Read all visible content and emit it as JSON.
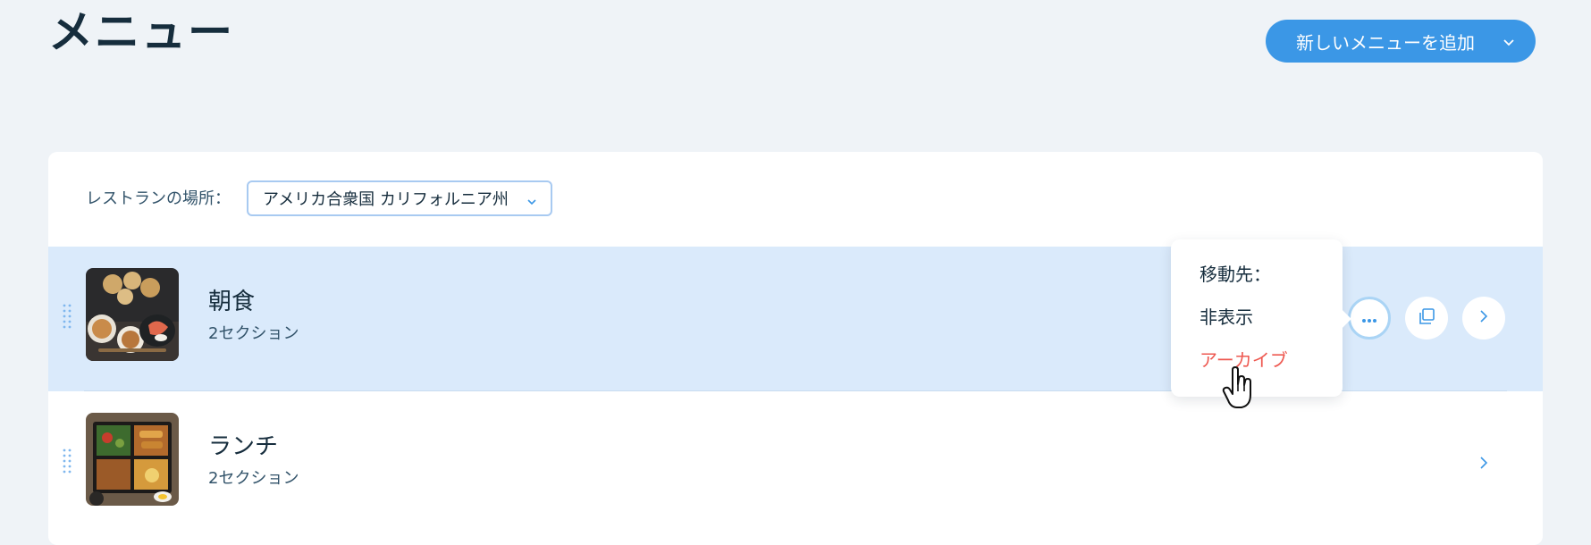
{
  "header": {
    "title": "メニュー",
    "add_button_label": "新しいメニューを追加"
  },
  "filter": {
    "location_label": "レストランの場所：",
    "location_value": "アメリカ合衆国 カリフォルニア州"
  },
  "menus": [
    {
      "name": "朝食",
      "sections": "2セクション",
      "image": "breakfast-photo"
    },
    {
      "name": "ランチ",
      "sections": "2セクション",
      "image": "lunch-bento-photo"
    }
  ],
  "context_menu": {
    "items": [
      "移動先：",
      "非表示",
      "アーカイブ"
    ]
  },
  "icons": {
    "add_button": "chevron-down-icon",
    "location_select": "chevron-down-icon",
    "drag": "drag-handle-icon",
    "more": "more-icon",
    "duplicate": "duplicate-icon",
    "open": "chevron-right-icon",
    "cursor": "hand-pointer-icon"
  },
  "colors": {
    "background": "#eff3f7",
    "primary": "#3b97e6",
    "selected_row": "#daeafb",
    "danger": "#ee5951",
    "text": "#162d3d"
  }
}
